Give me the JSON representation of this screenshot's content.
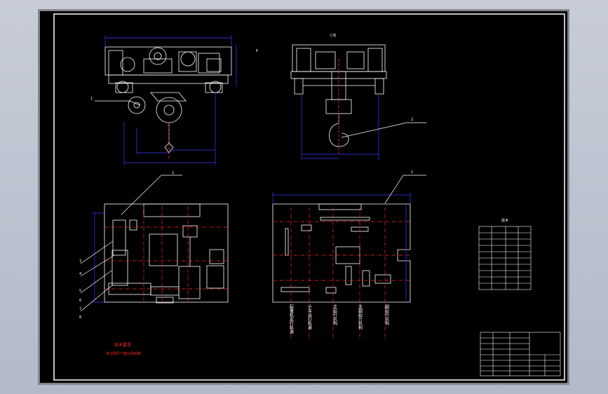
{
  "drawing": {
    "view_labels": {
      "top_right_view": "C向",
      "side_mark": "E",
      "parts_table_title": "技术"
    },
    "callouts": [
      "1",
      "2",
      "3",
      "4",
      "5",
      "6",
      "7",
      "8",
      "2",
      "1"
    ],
    "bottom_vertical_labels": [
      "起重机走行轨道",
      "小车运行轨道",
      "主起升机构",
      "主副起升机构",
      "副起升机构"
    ],
    "tech_note_title": "技术要求",
    "tech_note_text": "未注明尺寸按比例绘制",
    "colors": {
      "line": "#ffffff",
      "dimension": "#3a3aff",
      "centerline": "#ff2a2a",
      "background": "#000000"
    }
  }
}
